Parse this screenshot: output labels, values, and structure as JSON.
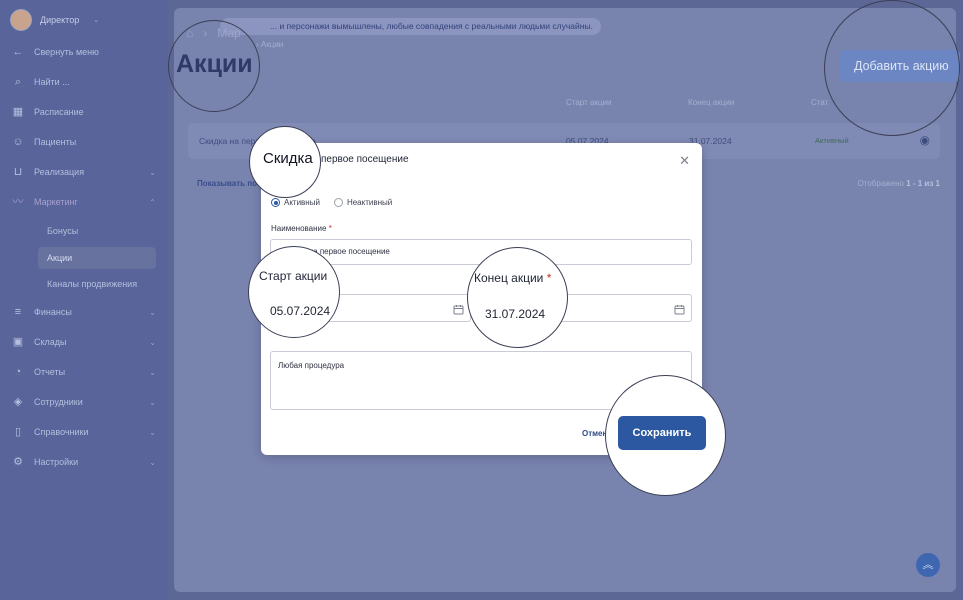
{
  "user": {
    "name": "Директор"
  },
  "sidebar": {
    "collapse": "Свернуть меню",
    "search": "Найти ...",
    "items": [
      {
        "label": "Расписание",
        "icon": "calendar-icon"
      },
      {
        "label": "Пациенты",
        "icon": "users-icon"
      },
      {
        "label": "Реализация",
        "icon": "cart-icon"
      },
      {
        "label": "Маркетинг",
        "icon": "trend-icon"
      },
      {
        "label": "Финансы",
        "icon": "database-icon"
      },
      {
        "label": "Склады",
        "icon": "box-icon"
      },
      {
        "label": "Отчеты",
        "icon": "chart-icon"
      },
      {
        "label": "Сотрудники",
        "icon": "people-icon"
      },
      {
        "label": "Справочники",
        "icon": "book-icon"
      },
      {
        "label": "Настройки",
        "icon": "gear-icon"
      }
    ],
    "marketing_sub": [
      "Бонусы",
      "Акции",
      "Каналы продвижения"
    ]
  },
  "main": {
    "notice": "... и персонажи вымышлены, любые совпадения с реальными людьми случайны.",
    "breadcrumb": "Мар",
    "breadcrumb_current": "Акции",
    "title": "Акции",
    "add_button": "Добавить акцию",
    "columns": {
      "start": "Старт акции",
      "end": "Конец акции",
      "status": "Стат"
    },
    "row": {
      "name": "Скидка на первое посещение",
      "start": "05.07.2024",
      "end": "31.07.2024",
      "status": "Активный"
    },
    "show_per_page": "Показывать по",
    "pager_prefix": "Отображено",
    "pager_range": "1 - 1 из 1"
  },
  "modal": {
    "title_zoom": "Скидка",
    "title_rest": "первое посещение",
    "status_active": "Активный",
    "status_inactive": "Неактивный",
    "name_label": "Наименование",
    "name_value": "Скидка на первое посещение",
    "start_label": "Старт акции",
    "start_value": "05.07.2024",
    "end_label": "Конец акции",
    "end_value": "31.07.2024",
    "description_value": "Любая процедура",
    "cancel": "Отмен",
    "save": "Сохранить"
  },
  "colors": {
    "accent": "#2b58a0",
    "required": "#d02a2a"
  }
}
